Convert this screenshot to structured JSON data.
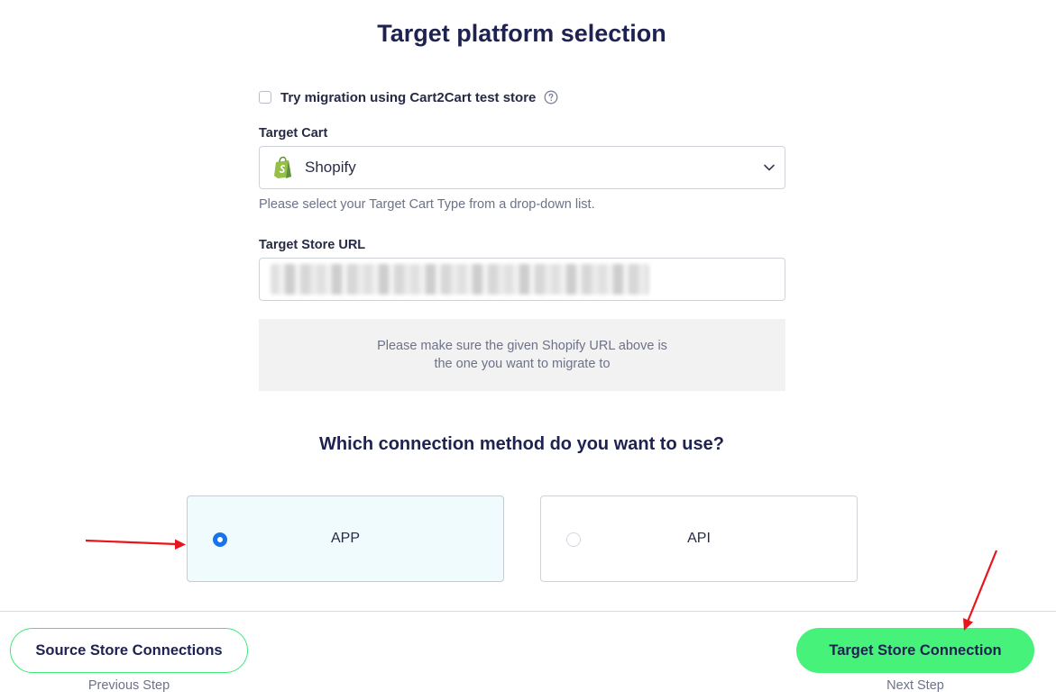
{
  "page": {
    "title": "Target platform selection"
  },
  "test_store": {
    "label": "Try migration using Cart2Cart test store",
    "checked": false,
    "help_icon": "question-circle-icon"
  },
  "target_cart": {
    "label": "Target Cart",
    "selected_value": "Shopify",
    "logo_icon": "shopify-bag-icon",
    "dropdown_icon": "chevron-down-icon",
    "hint": "Please select your Target Cart Type from a drop-down list."
  },
  "target_url": {
    "label": "Target Store URL",
    "value": ""
  },
  "notice": {
    "line1": "Please make sure the given Shopify URL above is",
    "line2": "the one you want to migrate to"
  },
  "connection": {
    "question": "Which connection method do you want to use?",
    "options": [
      {
        "label": "APP",
        "selected": true
      },
      {
        "label": "API",
        "selected": false
      }
    ]
  },
  "footer": {
    "prev_button": "Source Store Connections",
    "prev_caption": "Previous Step",
    "next_button": "Target Store Connection",
    "next_caption": "Next Step"
  },
  "colors": {
    "heading": "#1e2251",
    "accent_green": "#47f27b",
    "radio_blue": "#1a73e8",
    "annotation_red": "#e8151c"
  }
}
